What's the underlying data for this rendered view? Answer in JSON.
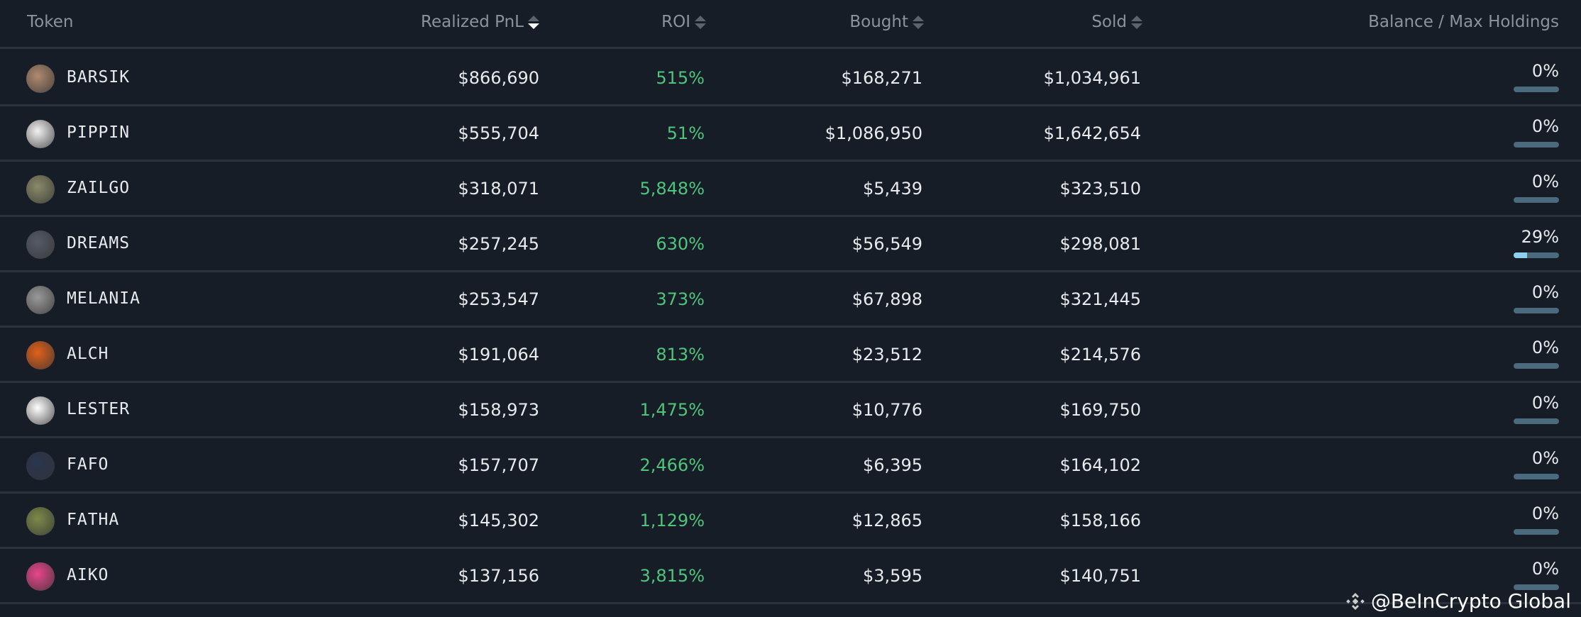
{
  "header": {
    "token": "Token",
    "pnl": "Realized PnL",
    "roi": "ROI",
    "bought": "Bought",
    "sold": "Sold",
    "balance": "Balance / Max Holdings"
  },
  "rows": [
    {
      "token": "BARSIK",
      "pnl": "$866,690",
      "roi": "515%",
      "bought": "$168,271",
      "sold": "$1,034,961",
      "balance": "0%",
      "fill": 0,
      "color": "#b08a70"
    },
    {
      "token": "PIPPIN",
      "pnl": "$555,704",
      "roi": "51%",
      "bought": "$1,086,950",
      "sold": "$1,642,654",
      "balance": "0%",
      "fill": 0,
      "color": "#f2f2f2"
    },
    {
      "token": "ZAILGO",
      "pnl": "$318,071",
      "roi": "5,848%",
      "bought": "$5,439",
      "sold": "$323,510",
      "balance": "0%",
      "fill": 0,
      "color": "#8a8a6a"
    },
    {
      "token": "DREAMS",
      "pnl": "$257,245",
      "roi": "630%",
      "bought": "$56,549",
      "sold": "$298,081",
      "balance": "29%",
      "fill": 29,
      "color": "#555b66"
    },
    {
      "token": "MELANIA",
      "pnl": "$253,547",
      "roi": "373%",
      "bought": "$67,898",
      "sold": "$321,445",
      "balance": "0%",
      "fill": 0,
      "color": "#9a9a9a"
    },
    {
      "token": "ALCH",
      "pnl": "$191,064",
      "roi": "813%",
      "bought": "$23,512",
      "sold": "$214,576",
      "balance": "0%",
      "fill": 0,
      "color": "#e0601a"
    },
    {
      "token": "LESTER",
      "pnl": "$158,973",
      "roi": "1,475%",
      "bought": "$10,776",
      "sold": "$169,750",
      "balance": "0%",
      "fill": 0,
      "color": "#ffffff"
    },
    {
      "token": "FAFO",
      "pnl": "$157,707",
      "roi": "2,466%",
      "bought": "$6,395",
      "sold": "$164,102",
      "balance": "0%",
      "fill": 0,
      "color": "#2a3550"
    },
    {
      "token": "FATHA",
      "pnl": "$145,302",
      "roi": "1,129%",
      "bought": "$12,865",
      "sold": "$158,166",
      "balance": "0%",
      "fill": 0,
      "color": "#7d8a4a"
    },
    {
      "token": "AIKO",
      "pnl": "$137,156",
      "roi": "3,815%",
      "bought": "$3,595",
      "sold": "$140,751",
      "balance": "0%",
      "fill": 0,
      "color": "#e8468a"
    }
  ],
  "watermark": "@BeInCrypto Global"
}
